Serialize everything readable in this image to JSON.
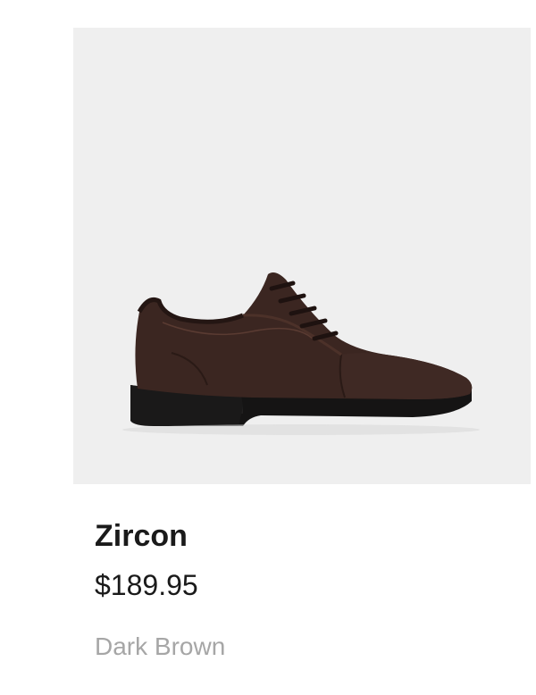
{
  "product": {
    "name": "Zircon",
    "price": "$189.95",
    "color_name": "Dark Brown",
    "image_icon": "shoe-oxford-icon"
  },
  "colors": {
    "image_background": "#efefef",
    "leather": "#3b2621",
    "sole": "#111111",
    "title_text": "#1a1a1a",
    "muted_text": "#a6a6a6"
  }
}
